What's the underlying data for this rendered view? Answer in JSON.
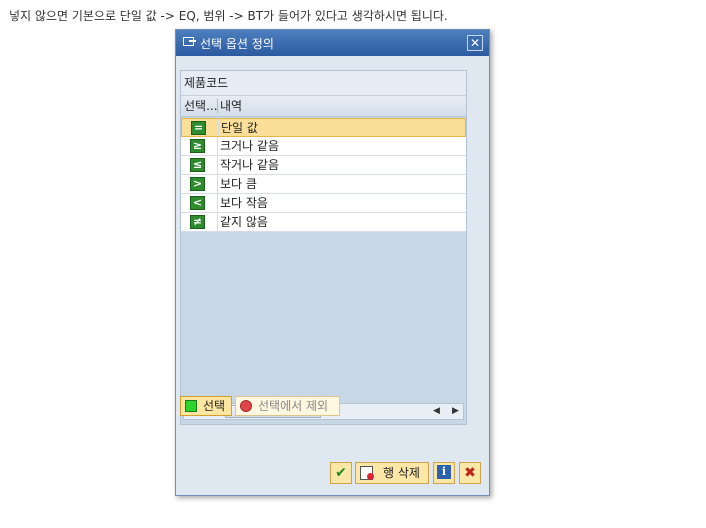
{
  "caption": "넣지 않으면 기본으로 단일 값 -> EQ, 범위 -> BT가 들어가 있다고 생각하시면 됩니다.",
  "dialog": {
    "title": "선택 옵션 정의",
    "close_symbol": "✕"
  },
  "panel": {
    "title": "제품코드",
    "columns": [
      "선택...",
      "내역"
    ],
    "rows": [
      {
        "icon": "equals-icon",
        "symbol": "=",
        "label": "단일 값",
        "selected": true
      },
      {
        "icon": "greater-equal-icon",
        "symbol": "≥",
        "label": "크거나 같음",
        "selected": false
      },
      {
        "icon": "less-equal-icon",
        "symbol": "≤",
        "label": "작거나 같음",
        "selected": false
      },
      {
        "icon": "greater-than-icon",
        "symbol": ">",
        "label": "보다 큼",
        "selected": false
      },
      {
        "icon": "less-than-icon",
        "symbol": "<",
        "label": "보다 작음",
        "selected": false
      },
      {
        "icon": "not-equal-icon",
        "symbol": "≠",
        "label": "같지 않음",
        "selected": false
      }
    ],
    "scroll_grip": ":::"
  },
  "toggle": {
    "select_label": "선택",
    "exclude_label": "선택에서 제외"
  },
  "footer": {
    "ok_symbol": "✔",
    "delete_row_label": "행 삭제",
    "info_symbol": "i",
    "cancel_symbol": "✖"
  },
  "colors": {
    "title_bar": "#2c5aa0",
    "selected_row": "#fbdf99",
    "operator_icon": "#2e8b2e",
    "button_face": "#fce7a6"
  }
}
